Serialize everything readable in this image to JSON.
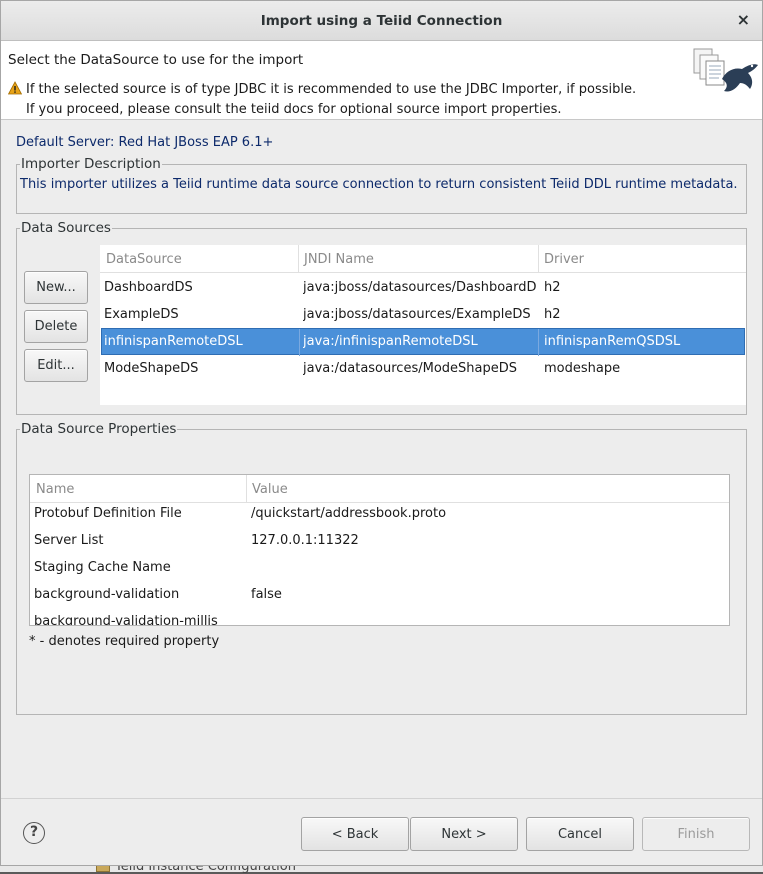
{
  "window": {
    "title": "Import using a Teiid Connection",
    "close_glyph": "×"
  },
  "header": {
    "title": "Select the DataSource to use for the import",
    "warning_line1": "If the selected source is of type JDBC it is recommended to use the JDBC Importer, if possible.",
    "warning_line2": "If you proceed, please consult the teiid docs for optional source import properties."
  },
  "server": "Default Server: Red Hat JBoss EAP 6.1+",
  "importer_description": {
    "legend": "Importer Description",
    "text": "This importer utilizes a Teiid runtime data source connection to return consistent Teiid DDL runtime metadata."
  },
  "data_sources": {
    "legend": "Data Sources",
    "buttons": {
      "new": "New...",
      "delete": "Delete",
      "edit": "Edit..."
    },
    "columns": [
      "DataSource",
      "JNDI Name",
      "Driver"
    ],
    "rows": [
      [
        "DashboardDS",
        "java:jboss/datasources/DashboardDS",
        "h2"
      ],
      [
        "ExampleDS",
        "java:jboss/datasources/ExampleDS",
        "h2"
      ],
      [
        "infinispanRemoteDSL",
        "java:/infinispanRemoteDSL",
        "infinispanRemQSDSL"
      ],
      [
        "ModeShapeDS",
        "java:/datasources/ModeShapeDS",
        "modeshape"
      ]
    ],
    "selected_index": 2
  },
  "properties": {
    "legend": "Data Source Properties",
    "columns": [
      "Name",
      "Value"
    ],
    "rows": [
      [
        "Protobuf Definition File",
        "/quickstart/addressbook.proto"
      ],
      [
        "Server List",
        "127.0.0.1:11322"
      ],
      [
        "Staging Cache Name",
        ""
      ],
      [
        "background-validation",
        "false"
      ],
      [
        "background-validation-millis",
        ""
      ]
    ],
    "required_note": "* - denotes required property"
  },
  "footer": {
    "help": "?",
    "back": "< Back",
    "next": "Next >",
    "cancel": "Cancel",
    "finish": "Finish"
  },
  "background": {
    "text": "Teiid Instance Configuration"
  },
  "colors": {
    "selection": "#4a90d9",
    "server_text": "#0d2a6b",
    "warning": "#e8a317"
  },
  "icons": {
    "warning": "warning-icon",
    "help": "help-icon",
    "banner": "import-wizard-banner-icon",
    "close": "close-icon"
  }
}
